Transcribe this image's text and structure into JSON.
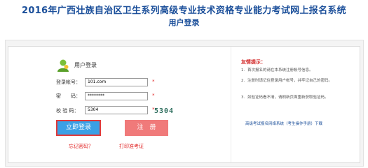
{
  "header": {
    "title": "2016年广西壮族自治区卫生系列高级专业技术资格专业能力考试网上报名系统",
    "subtitle": "用户登录"
  },
  "login": {
    "heading": "用户登录",
    "username_label": "登录帐号：",
    "username_value": "101.com",
    "password_label": "密　　码：",
    "password_value": "********",
    "captcha_label": "校 验 码：",
    "captcha_value": "5304",
    "captcha_code": "5304",
    "required_mark": "*",
    "login_button": "立即登录",
    "register_button": "注　册",
    "forgot_link": "忘记密码？",
    "print_link": "打印准考证"
  },
  "tips": {
    "title": "友情提示：",
    "items": [
      {
        "num": "1.",
        "text": "首次报名的请在本系统注册帐号信息。"
      },
      {
        "num": "2.",
        "text": "注册时请记住登录用户帐号，并牢记自己的密码。"
      },
      {
        "num": "3.",
        "text": "如验证码看不清，请刷新页面重新获取验证码。"
      }
    ],
    "download_link": "高级考试报名网络系统（考生操作手册）下载"
  },
  "colors": {
    "title": "#1b4f9a",
    "login_button": "#3aa0e6",
    "register_button": "#f07a7a",
    "accent_red": "#e02020"
  }
}
